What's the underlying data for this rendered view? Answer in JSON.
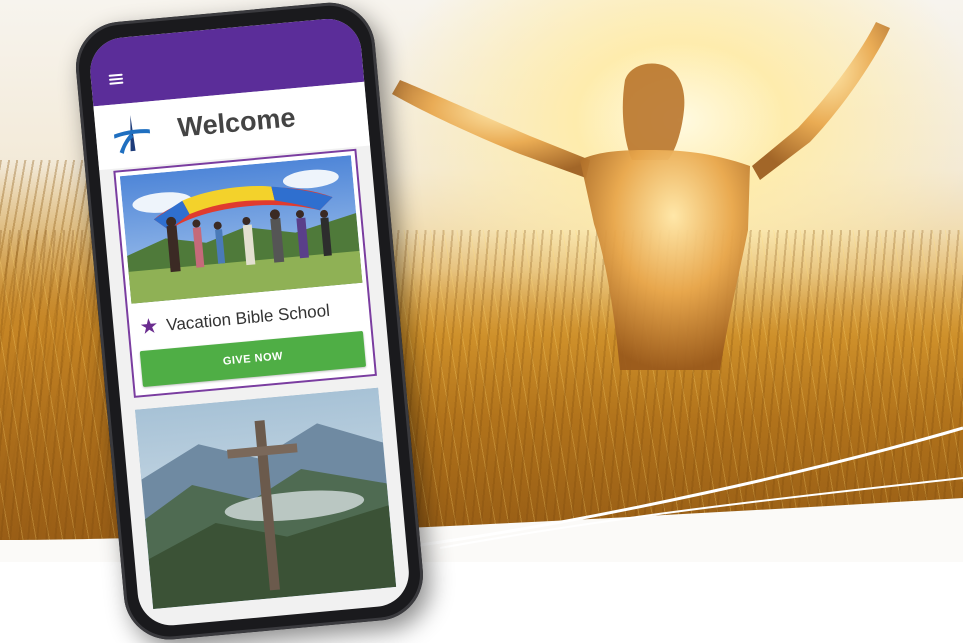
{
  "app": {
    "welcome_title": "Welcome",
    "menu_icon": "hamburger-menu-icon",
    "logo": "cross-logo"
  },
  "event_card": {
    "title": "Vacation Bible School",
    "icon": "star-icon",
    "cta_label": "GIVE NOW"
  },
  "colors": {
    "app_bar": "#5b2d99",
    "card_border": "#7a3da0",
    "star": "#6a2c8f",
    "cta": "#4fae45",
    "logo_blue": "#1f6fc0",
    "logo_navy": "#1d3c7a"
  }
}
